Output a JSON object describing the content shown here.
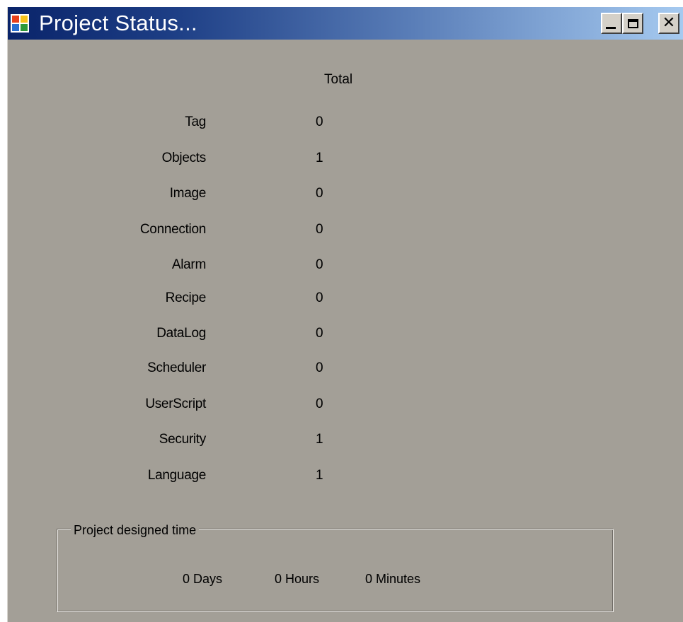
{
  "window": {
    "title": "Project Status...",
    "icon": "app-window-icon",
    "controls": {
      "minimize": "minimize-icon",
      "maximize": "maximize-icon",
      "close": "close-icon"
    }
  },
  "table": {
    "header": "Total",
    "rows": [
      {
        "label": "Tag",
        "value": "0"
      },
      {
        "label": "Objects",
        "value": "1"
      },
      {
        "label": "Image",
        "value": "0"
      },
      {
        "label": "Connection",
        "value": "0"
      },
      {
        "label": "Alarm",
        "value": "0"
      },
      {
        "label": "Recipe",
        "value": "0"
      },
      {
        "label": "DataLog",
        "value": "0"
      },
      {
        "label": "Scheduler",
        "value": "0"
      },
      {
        "label": "UserScript",
        "value": "0"
      },
      {
        "label": "Security",
        "value": "1"
      },
      {
        "label": "Language",
        "value": "1"
      }
    ]
  },
  "design_time": {
    "title": "Project designed time",
    "days": "0 Days",
    "hours": "0 Hours",
    "minutes": "0 Minutes"
  }
}
